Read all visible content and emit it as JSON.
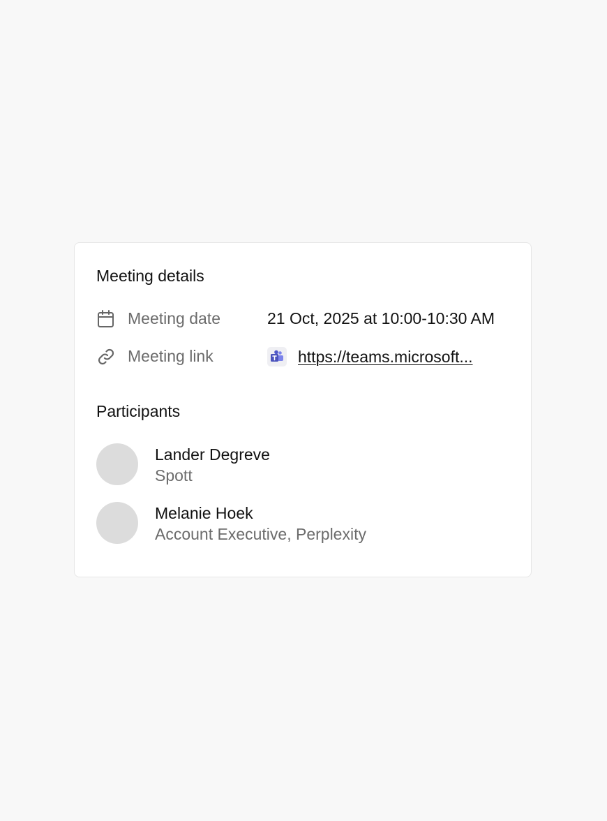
{
  "meeting_details": {
    "title": "Meeting details",
    "date": {
      "icon": "calendar-icon",
      "label": "Meeting date",
      "value": "21 Oct, 2025 at 10:00-10:30 AM"
    },
    "link": {
      "icon": "link-icon",
      "app_icon": "microsoft-teams-icon",
      "label": "Meeting link",
      "value": "https://teams.microsoft..."
    }
  },
  "participants": {
    "title": "Participants",
    "items": [
      {
        "name": "Lander Degreve",
        "role": "Spott"
      },
      {
        "name": "Melanie Hoek",
        "role": "Account Executive, Perplexity"
      }
    ]
  },
  "colors": {
    "background": "#f8f8f8",
    "card": "#ffffff",
    "avatar": "#dcdcdc",
    "muted_text": "#6b6b6b",
    "teams_purple": "#5059c9"
  }
}
